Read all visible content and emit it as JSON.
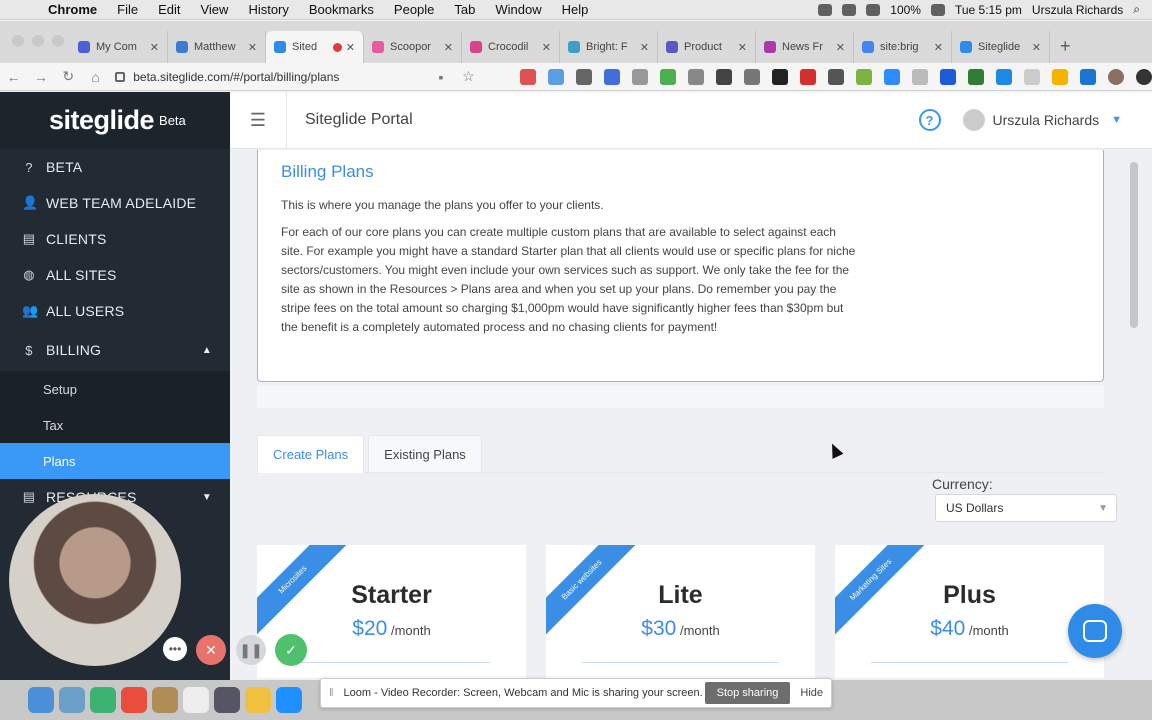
{
  "menubar": {
    "app": "Chrome",
    "items": [
      "File",
      "Edit",
      "View",
      "History",
      "Bookmarks",
      "People",
      "Tab",
      "Window",
      "Help"
    ],
    "battery": "100%",
    "clock": "Tue 5:15 pm",
    "user": "Urszula Richards"
  },
  "tabs": [
    {
      "label": "My Com",
      "color": "#4b5fd6"
    },
    {
      "label": "Matthew",
      "color": "#3c7bd4"
    },
    {
      "label": "Sited",
      "color": "#2e8be8",
      "active": true
    },
    {
      "label": "Scoopor",
      "color": "#e75a9b"
    },
    {
      "label": "Crocodil",
      "color": "#d9438e"
    },
    {
      "label": "Bright: F",
      "color": "#3aa0c8"
    },
    {
      "label": "Product",
      "color": "#5757c6"
    },
    {
      "label": "News Fr",
      "color": "#aa3aa8"
    },
    {
      "label": "site:brig",
      "color": "#4285f4"
    },
    {
      "label": "Siteglide",
      "color": "#2e8be8"
    }
  ],
  "address": {
    "url": "beta.siteglide.com/#/portal/billing/plans"
  },
  "sidebar": {
    "logo": "siteglide",
    "badge": "Beta",
    "items": [
      {
        "label": "BETA",
        "icon": "?"
      },
      {
        "label": "WEB TEAM ADELAIDE",
        "icon": "👤"
      },
      {
        "label": "CLIENTS",
        "icon": "▤"
      },
      {
        "label": "ALL SITES",
        "icon": "◍"
      },
      {
        "label": "ALL USERS",
        "icon": "👥"
      }
    ],
    "billing": {
      "label": "BILLING",
      "icon": "$"
    },
    "subitems": [
      "Setup",
      "Tax",
      "Plans"
    ],
    "resources": {
      "label": "RESOURCES",
      "icon": "▤"
    }
  },
  "header": {
    "title": "Siteglide Portal",
    "help": "?",
    "user": "Urszula Richards"
  },
  "info": {
    "title": "Billing Plans",
    "intro": "This is where you manage the plans you offer to your clients.",
    "body": "For each of our core plans you can create multiple custom plans that are available to select against each site. For example you might have a standard Starter plan that all clients would use or specific plans for niche sectors/customers. You might even include your own services such as support. We only take the fee for the site as shown in the Resources > Plans area and when you set up your plans. Do remember you pay the stripe fees on the total amount so charging $1,000pm would have significantly higher fees than $30pm but the benefit is a completely automated process and no chasing clients for payment!"
  },
  "plan_tabs": [
    "Create Plans",
    "Existing Plans"
  ],
  "currency": {
    "label": "Currency:",
    "value": "US Dollars"
  },
  "plans": [
    {
      "ribbon": "Microsites",
      "name": "Starter",
      "price": "$20",
      "period": "/month"
    },
    {
      "ribbon": "Basic websites",
      "name": "Lite",
      "price": "$30",
      "period": "/month"
    },
    {
      "ribbon": "Marketing Sites",
      "name": "Plus",
      "price": "$40",
      "period": "/month"
    }
  ],
  "loom": {
    "message": "Loom - Video Recorder: Screen, Webcam and Mic is sharing your screen.",
    "stop": "Stop sharing",
    "hide": "Hide"
  },
  "colors": {
    "accent": "#3a99f6",
    "sidebar": "#222b33"
  }
}
